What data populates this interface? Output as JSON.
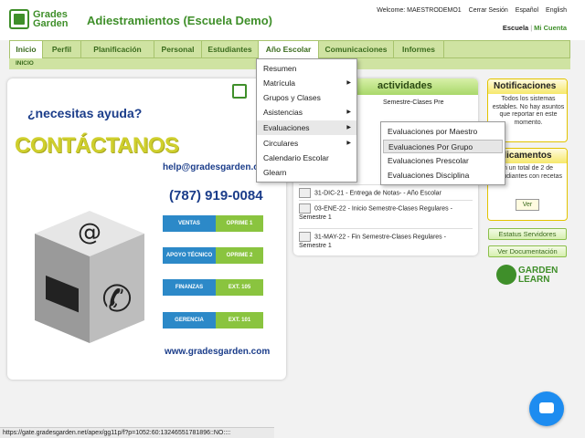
{
  "header": {
    "logo_line1": "Grades",
    "logo_line2": "Garden",
    "title": "Adiestramientos (Escuela Demo)",
    "welcome": "Welcome: MAESTRODEMO1",
    "logout": "Cerrar Sesión",
    "lang_es": "Español",
    "lang_en": "English",
    "school": "Escuela",
    "my_account": "Mi Cuenta"
  },
  "nav": {
    "items": [
      "Inicio",
      "Perfil",
      "Planificación",
      "Personal",
      "Estudiantes",
      "Año Escolar",
      "Comunicaciones",
      "Informes"
    ],
    "sub_label": "INICIO"
  },
  "banner": {
    "help": "¿necesitas ayuda?",
    "contact": "CONTÁCTANOS",
    "email": "help@gradesgarden.c",
    "phone": "(787) 919-0084",
    "rows": [
      {
        "left": "VENTAS",
        "right": "OPRIME 1"
      },
      {
        "left": "APOYO TÉCNICO",
        "right": "OPRIME 2"
      },
      {
        "left": "FINANZAS",
        "right": "EXT. 105"
      },
      {
        "left": "GERENCIA",
        "right": "EXT. 101"
      }
    ],
    "site": "www.gradesgarden.com"
  },
  "activities": {
    "title": "actividades",
    "items": [
      "Semestre-Clases Pre",
      "31-DIC-21 - Entrega de Notas- - Año Escolar",
      "03-ENE-22 - Inicio Semestre-Clases Regulares - Semestre 1",
      "31-MAY-22 - Fin Semestre-Clases Regulares - Semestre 1"
    ]
  },
  "notifications": {
    "title": "Notificaciones",
    "body": "Todos los sistemas estables. No hay asuntos que reportar en este momento."
  },
  "medications": {
    "title": "dicamentos",
    "body": "n un total de 2 de estudiantes con recetas",
    "button": "Ver"
  },
  "side_buttons": {
    "status": "Estatus Servidores",
    "docs": "Ver Documentación"
  },
  "garden_learn": {
    "line1": "GARDEN",
    "line2": "LEARN"
  },
  "menu": {
    "items": [
      "Resumen",
      "Matrícula",
      "Grupos y Clases",
      "Asistencias",
      "Evaluaciones",
      "Circulares",
      "Calendario Escolar",
      "Glearn"
    ]
  },
  "submenu": {
    "items": [
      "Evaluaciones por Maestro",
      "Evaluaciones Por Grupo",
      "Evaluaciones Prescolar",
      "Evaluaciones Disciplina"
    ]
  },
  "statusbar": {
    "url": "https://gate.gradesgarden.net/apex/gg11p/f?p=1052:60:13246551781896::NO::::"
  }
}
